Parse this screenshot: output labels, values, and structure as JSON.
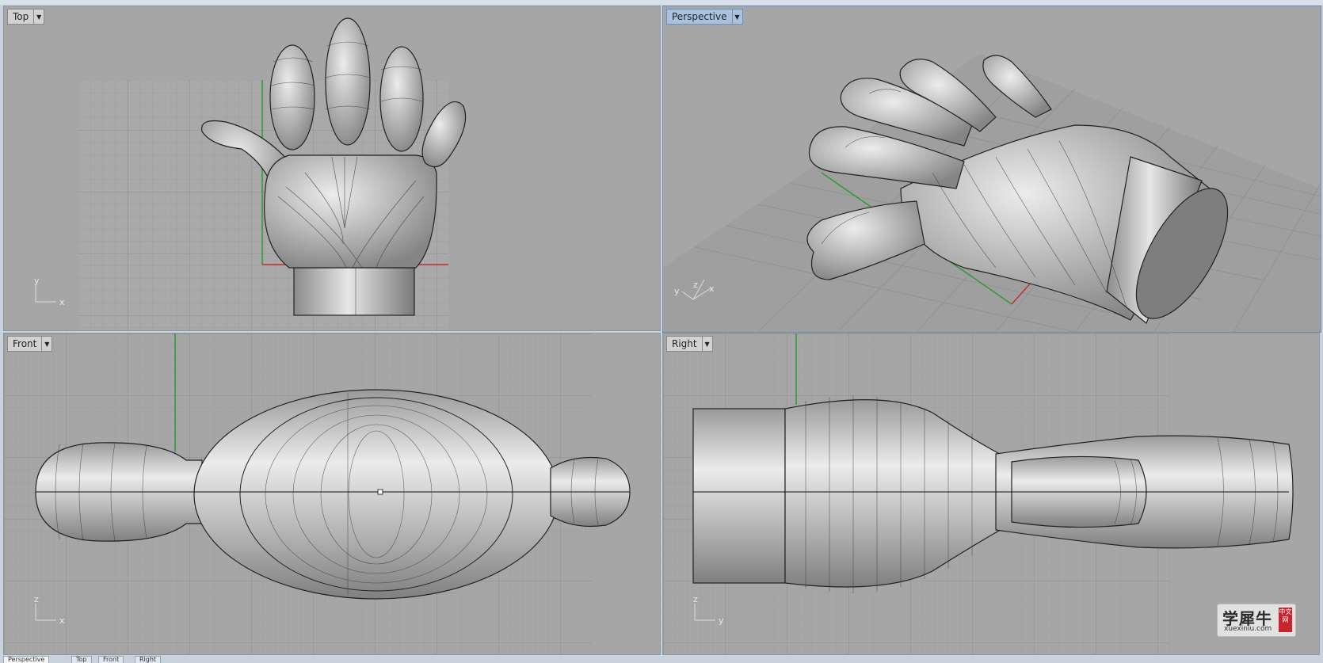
{
  "viewports": {
    "top": {
      "label": "Top",
      "axis_h": "x",
      "axis_v": "y"
    },
    "perspective": {
      "label": "Perspective",
      "axis_a": "y",
      "axis_b": "z",
      "axis_c": "x"
    },
    "front": {
      "label": "Front",
      "axis_h": "x",
      "axis_v": "z"
    },
    "right": {
      "label": "Right",
      "axis_h": "y",
      "axis_v": "z"
    }
  },
  "tabs": [
    {
      "label": "Perspective"
    },
    {
      "label": "Top"
    },
    {
      "label": "Front"
    },
    {
      "label": "Right"
    }
  ],
  "watermark": {
    "main": "学犀牛",
    "sub": "xuexiniu.com",
    "seal": "中文网"
  },
  "icons": {
    "dropdown": "chevron-down-icon"
  },
  "colors": {
    "viewport_bg": "#a6a6a6",
    "grid": "#9b9b9b",
    "x_axis": "#c03030",
    "y_axis": "#30a030",
    "active_label": "#a9c2df",
    "model": "#c8c8c8"
  }
}
